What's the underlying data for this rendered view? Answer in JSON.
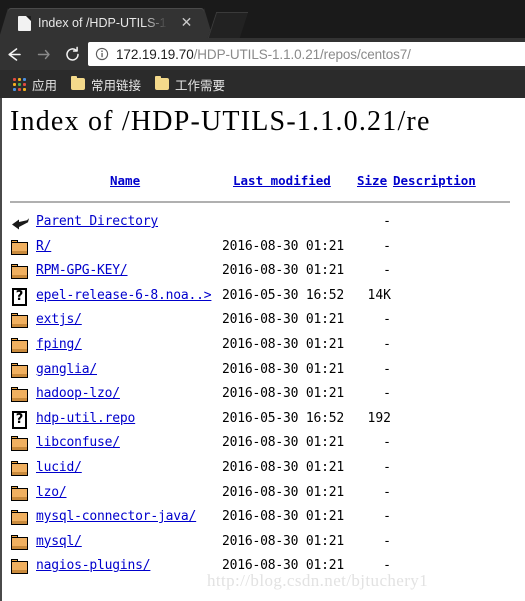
{
  "browser": {
    "tab": {
      "title": "Index of /HDP-UTILS-1",
      "close_label": "✕"
    },
    "toolbar": {
      "back_label": "Back",
      "forward_label": "Forward",
      "reload_label": "Reload",
      "url_host": "172.19.19.70",
      "url_path": "/HDP-UTILS-1.1.0.21/repos/centos7/",
      "security_icon": "info-circle-icon"
    },
    "bookmarks": [
      {
        "label": "应用",
        "icon": "apps-grid-icon"
      },
      {
        "label": "常用链接",
        "icon": "folder-icon"
      },
      {
        "label": "工作需要",
        "icon": "folder-icon"
      }
    ],
    "colors": {
      "tab_active": "#333333",
      "toolbar": "#333333",
      "bookmarks_bar": "#2b2b2b",
      "link": "#0000cc"
    }
  },
  "page": {
    "title": "Index of /HDP-UTILS-1.1.0.21/re",
    "columns": {
      "name": "Name",
      "last_modified": "Last modified",
      "size": "Size",
      "description": "Description"
    },
    "watermark": "http://blog.csdn.net/bjtuchery1",
    "entries": [
      {
        "icon": "parent-directory-icon",
        "name": "Parent Directory",
        "modified": "",
        "size": "-"
      },
      {
        "icon": "folder-icon",
        "name": "R/",
        "modified": "2016-08-30 01:21",
        "size": "-"
      },
      {
        "icon": "folder-icon",
        "name": "RPM-GPG-KEY/",
        "modified": "2016-08-30 01:21",
        "size": "-"
      },
      {
        "icon": "unknown-file-icon",
        "name": "epel-release-6-8.noa..>",
        "modified": "2016-05-30 16:52",
        "size": "14K"
      },
      {
        "icon": "folder-icon",
        "name": "extjs/",
        "modified": "2016-08-30 01:21",
        "size": "-"
      },
      {
        "icon": "folder-icon",
        "name": "fping/",
        "modified": "2016-08-30 01:21",
        "size": "-"
      },
      {
        "icon": "folder-icon",
        "name": "ganglia/",
        "modified": "2016-08-30 01:21",
        "size": "-"
      },
      {
        "icon": "folder-icon",
        "name": "hadoop-lzo/",
        "modified": "2016-08-30 01:21",
        "size": "-"
      },
      {
        "icon": "unknown-file-icon",
        "name": "hdp-util.repo",
        "modified": "2016-05-30 16:52",
        "size": "192"
      },
      {
        "icon": "folder-icon",
        "name": "libconfuse/",
        "modified": "2016-08-30 01:21",
        "size": "-"
      },
      {
        "icon": "folder-icon",
        "name": "lucid/",
        "modified": "2016-08-30 01:21",
        "size": "-"
      },
      {
        "icon": "folder-icon",
        "name": "lzo/",
        "modified": "2016-08-30 01:21",
        "size": "-"
      },
      {
        "icon": "folder-icon",
        "name": "mysql-connector-java/",
        "modified": "2016-08-30 01:21",
        "size": "-"
      },
      {
        "icon": "folder-icon",
        "name": "mysql/",
        "modified": "2016-08-30 01:21",
        "size": "-"
      },
      {
        "icon": "folder-icon",
        "name": "nagios-plugins/",
        "modified": "2016-08-30 01:21",
        "size": "-"
      }
    ]
  }
}
